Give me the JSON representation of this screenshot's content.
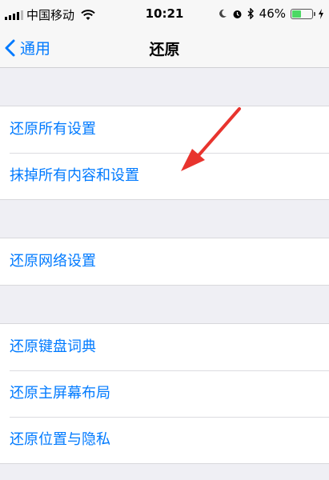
{
  "status_bar": {
    "carrier": "中国移动",
    "time": "10:21",
    "battery_percent": "46%",
    "battery_level": 0.46,
    "icons": [
      "signal-icon",
      "wifi-icon",
      "moon-icon",
      "alarm-icon",
      "bluetooth-icon",
      "battery-icon",
      "charging-icon"
    ]
  },
  "nav": {
    "back_label": "通用",
    "title": "还原"
  },
  "groups": [
    {
      "items": [
        {
          "label": "还原所有设置"
        },
        {
          "label": "抹掉所有内容和设置"
        }
      ]
    },
    {
      "items": [
        {
          "label": "还原网络设置"
        }
      ]
    },
    {
      "items": [
        {
          "label": "还原键盘词典"
        },
        {
          "label": "还原主屏幕布局"
        },
        {
          "label": "还原位置与隐私"
        }
      ]
    }
  ],
  "colors": {
    "accent": "#007aff",
    "background": "#efeff4",
    "annotation_arrow": "#e8342e",
    "battery_green": "#4cd964"
  }
}
